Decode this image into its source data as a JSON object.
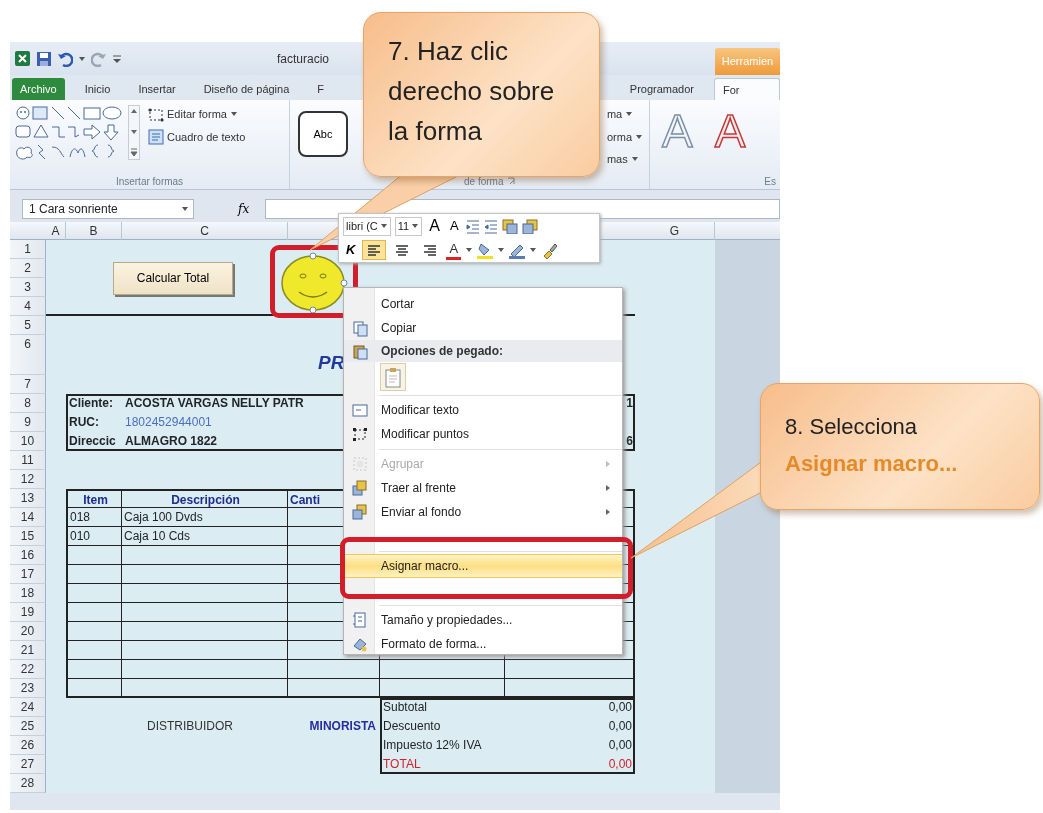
{
  "title_bar": {
    "title": "facturacio",
    "context_tab": "Herramien"
  },
  "ribbon_tabs": [
    {
      "label": "Archivo",
      "kind": "file",
      "selected": false
    },
    {
      "label": "Inicio",
      "kind": "tab",
      "selected": false
    },
    {
      "label": "Insertar",
      "kind": "tab",
      "selected": false
    },
    {
      "label": "Diseño de página",
      "kind": "tab",
      "selected": false
    },
    {
      "label": "F",
      "kind": "tab",
      "selected": false
    },
    {
      "label": "Programador",
      "kind": "tab",
      "selected": false
    },
    {
      "label": "For",
      "kind": "tab",
      "selected": true
    }
  ],
  "ribbon_groups": [
    {
      "kind": "shapes",
      "label": "Insertar formas",
      "buttons": [
        "Editar forma",
        "Cuadro de texto"
      ]
    },
    {
      "kind": "styles",
      "label": "de forma",
      "sample": "Abc",
      "buttons": [
        "ma",
        "orma",
        "mas"
      ]
    },
    {
      "kind": "wordart",
      "label": "Es",
      "samples": [
        "A",
        "A"
      ]
    }
  ],
  "formula_bar": {
    "name_box": "1 Cara sonriente",
    "function_label": "fx"
  },
  "sheet": {
    "column_headers": [
      "A",
      "B",
      "C",
      "G"
    ],
    "row_numbers": [
      "1",
      "2",
      "3",
      "4",
      "5",
      "6",
      "7",
      "8",
      "9",
      "10",
      "11",
      "12",
      "13",
      "14",
      "15",
      "16",
      "17",
      "18",
      "19",
      "20",
      "21",
      "22",
      "23",
      "24",
      "25",
      "26",
      "27",
      "28"
    ],
    "button": "Calcular Total",
    "heading": "PR",
    "client": [
      {
        "label": "Cliente:",
        "value": "ACOSTA VARGAS NELLY PATR",
        "kind": "name"
      },
      {
        "label": "RUC:",
        "value": "1802452944001",
        "kind": "id"
      },
      {
        "label": "Direccic",
        "value": "ALMAGRO 1822",
        "kind": "address"
      }
    ],
    "client_edge": [
      "1",
      "6"
    ],
    "items": {
      "columns": [
        "Item",
        "Descripción",
        "Canti"
      ],
      "rows": [
        [
          "018",
          "Caja 100 Dvds"
        ],
        [
          "010",
          "Caja 10 Cds"
        ]
      ]
    },
    "price_labels": [
      {
        "label": "DISTRIBUIDOR",
        "kind": "plain"
      },
      {
        "label": "MINORISTA",
        "kind": "emphasis"
      }
    ],
    "totals": [
      {
        "label": "Subtotal",
        "value": "0,00",
        "kind": "normal"
      },
      {
        "label": "Descuento",
        "value": "0,00",
        "kind": "normal"
      },
      {
        "label": "Impuesto 12% IVA",
        "value": "0,00",
        "kind": "normal"
      },
      {
        "label": "TOTAL",
        "value": "0,00",
        "kind": "total"
      }
    ]
  },
  "mini_toolbar": {
    "font": "libri (C",
    "size": "11",
    "grow": "A",
    "shrink": "A",
    "italic": "K",
    "font_color": "A",
    "alignments": [
      {
        "selected": true
      },
      {
        "selected": false
      },
      {
        "selected": false
      }
    ]
  },
  "context_menu": {
    "items": [
      {
        "kind": "item",
        "label": "Cortar",
        "disabled": false,
        "submenu": false,
        "selected": false
      },
      {
        "kind": "item",
        "label": "Copiar",
        "disabled": false,
        "submenu": false,
        "selected": false
      },
      {
        "kind": "header",
        "label": "Opciones de pegado:"
      },
      {
        "kind": "paste"
      },
      {
        "kind": "separator"
      },
      {
        "kind": "item",
        "label": "Modificar texto",
        "disabled": false,
        "submenu": false,
        "selected": false
      },
      {
        "kind": "item",
        "label": "Modificar puntos",
        "disabled": false,
        "submenu": false,
        "selected": false
      },
      {
        "kind": "separator"
      },
      {
        "kind": "item",
        "label": "Agrupar",
        "disabled": true,
        "submenu": true,
        "selected": false
      },
      {
        "kind": "item",
        "label": "Traer al frente",
        "disabled": false,
        "submenu": true,
        "selected": false
      },
      {
        "kind": "item",
        "label": "Enviar al fondo",
        "disabled": false,
        "submenu": true,
        "selected": false
      },
      {
        "kind": "obscured"
      },
      {
        "kind": "separator"
      },
      {
        "kind": "item",
        "label": "Asignar macro...",
        "disabled": false,
        "submenu": false,
        "selected": true
      },
      {
        "kind": "obscured"
      },
      {
        "kind": "separator"
      },
      {
        "kind": "item",
        "label": "Tamaño y propiedades...",
        "disabled": false,
        "submenu": false,
        "selected": false
      },
      {
        "kind": "item",
        "label": "Formato de forma...",
        "disabled": false,
        "submenu": false,
        "selected": false
      }
    ]
  },
  "callouts": [
    {
      "text": "7. Haz clic derecho sobre la forma"
    },
    {
      "text": "8. Selecciona **Asignar macro...**"
    }
  ]
}
